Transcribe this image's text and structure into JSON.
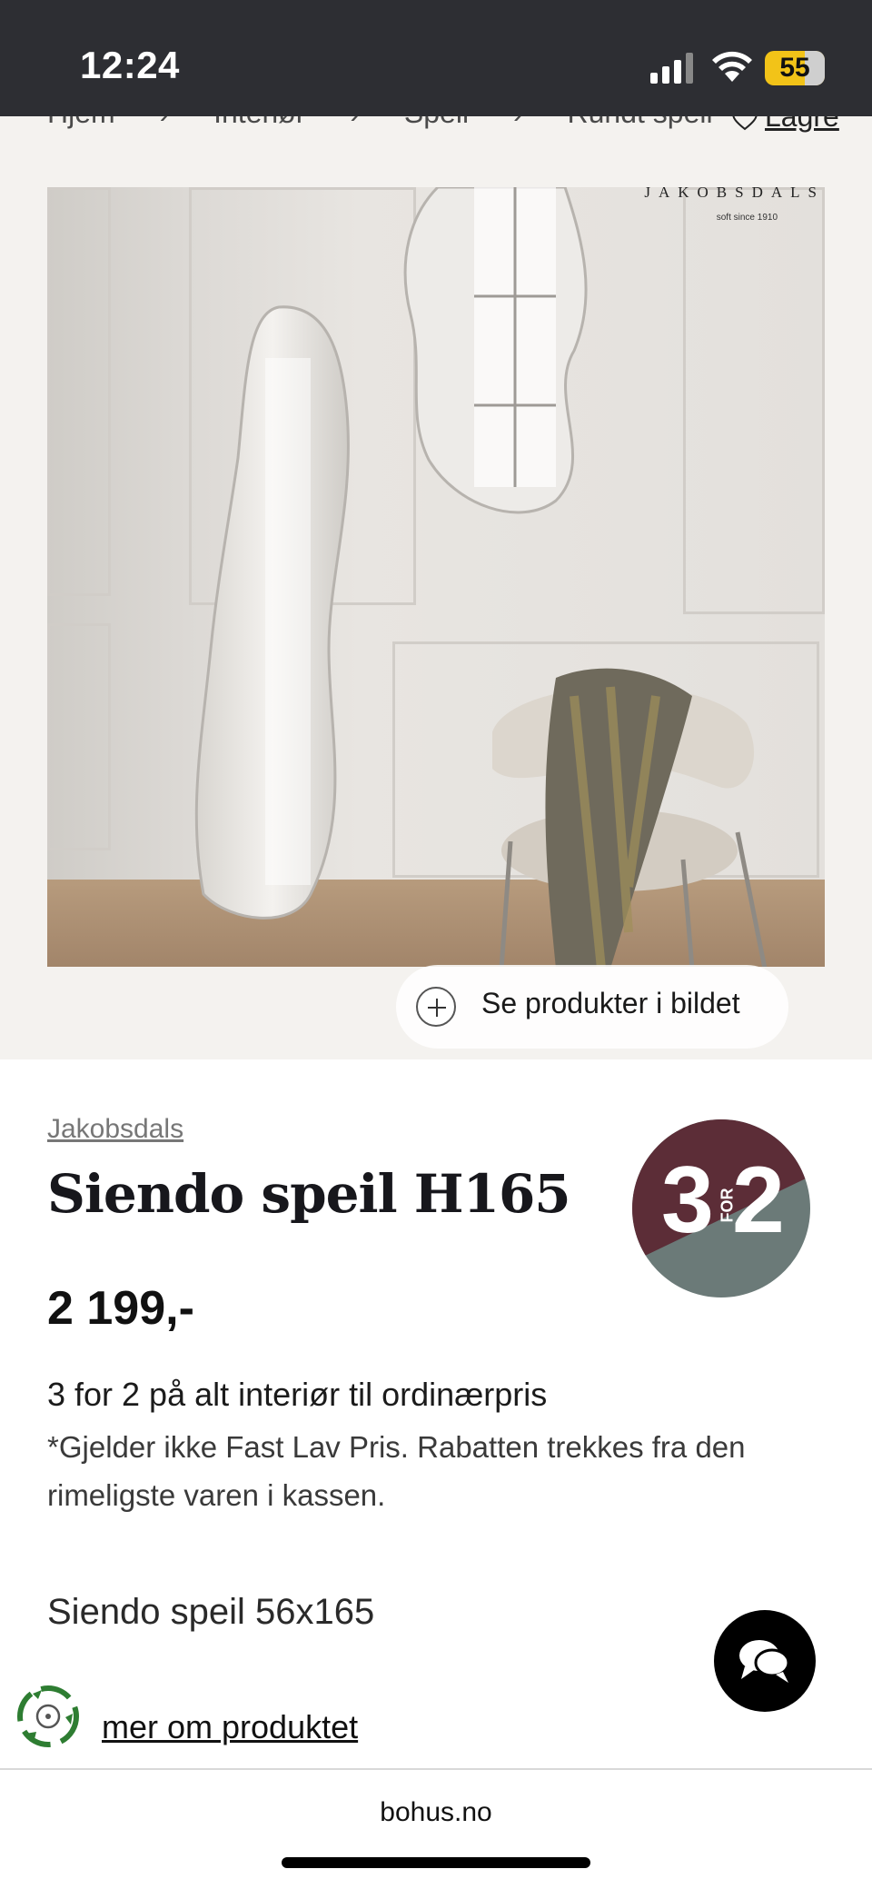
{
  "status_bar": {
    "time": "12:24",
    "battery": "55"
  },
  "breadcrumb": [
    "Hjem",
    "Interiør",
    "Speil",
    "Rundt speil"
  ],
  "favorite_label": "Lagre",
  "gallery": {
    "brand_logo": "JAKOBSDALS",
    "brand_sub": "soft since 1910",
    "see_products_label": "Se produkter i bildet",
    "image_count": 5,
    "active_index": 1
  },
  "product": {
    "brand": "Jakobsdals",
    "title": "Siendo speil H165",
    "price": "2 199,-",
    "badge": {
      "left": "3",
      "for": "FOR",
      "right": "2",
      "colors": {
        "top": "#5c2d37",
        "bottom": "#6b7a78"
      }
    },
    "promo_title": "3 for 2 på alt interiør til ordinærpris",
    "promo_desc": "*Gjelder ikke Fast Lav Pris. Rabatten trekkes fra den rimeligste varen i kassen.",
    "variant": "Siendo speil 56x165",
    "more_link": "mer om produktet"
  },
  "browser": {
    "url": "bohus.no"
  },
  "icons": [
    "signal-icon",
    "wifi-icon",
    "battery-icon",
    "heart-icon",
    "plus-icon",
    "zoom-icon",
    "chat-icon",
    "eco-icon"
  ]
}
